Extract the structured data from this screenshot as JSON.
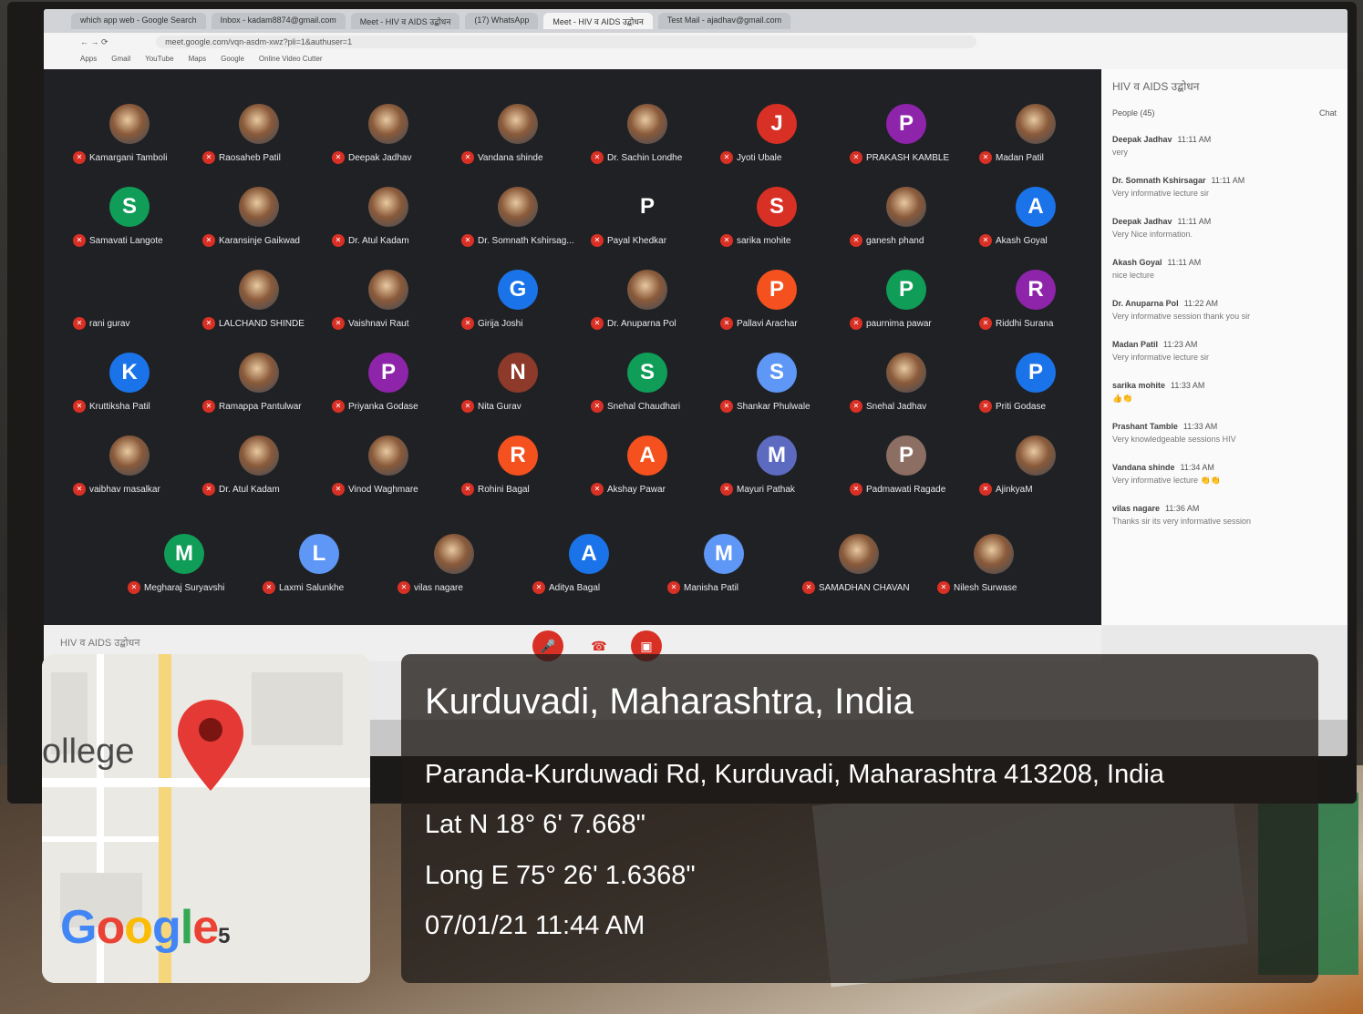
{
  "browser": {
    "tabs": [
      {
        "label": "which app web - Google Search",
        "active": false
      },
      {
        "label": "Inbox - kadam8874@gmail.com",
        "active": false
      },
      {
        "label": "Meet - HIV व AIDS उद्बोधन",
        "active": false
      },
      {
        "label": "(17) WhatsApp",
        "active": false
      },
      {
        "label": "Meet - HIV व AIDS उद्बोधन",
        "active": true
      },
      {
        "label": "Test Mail - ajadhav@gmail.com",
        "active": false
      }
    ],
    "url": "meet.google.com/vqn-asdm-xwz?pli=1&authuser=1",
    "bookmarks": [
      "Apps",
      "Gmail",
      "YouTube",
      "Maps",
      "Google",
      "Online Video Cutter"
    ]
  },
  "meet": {
    "participants": [
      {
        "name": "Kamargani Tamboli",
        "initial": "",
        "color": "",
        "photo": true
      },
      {
        "name": "Raosaheb Patil",
        "initial": "",
        "color": "",
        "photo": true
      },
      {
        "name": "Deepak Jadhav",
        "initial": "",
        "color": "",
        "photo": true
      },
      {
        "name": "Vandana shinde",
        "initial": "",
        "color": "",
        "photo": true
      },
      {
        "name": "Dr. Sachin Londhe",
        "initial": "",
        "color": "",
        "photo": true
      },
      {
        "name": "Jyoti Ubale",
        "initial": "J",
        "color": "#d93025",
        "photo": false
      },
      {
        "name": "PRAKASH KAMBLE",
        "initial": "P",
        "color": "#8e24aa",
        "photo": false
      },
      {
        "name": "Madan Patil",
        "initial": "",
        "color": "",
        "photo": true
      },
      {
        "name": "Samavati Langote",
        "initial": "S",
        "color": "#0f9d58",
        "photo": false
      },
      {
        "name": "Karansinje Gaikwad",
        "initial": "",
        "color": "",
        "photo": true
      },
      {
        "name": "Dr. Atul Kadam",
        "initial": "",
        "color": "",
        "photo": true
      },
      {
        "name": "Dr. Somnath Kshirsag...",
        "initial": "",
        "color": "",
        "photo": true
      },
      {
        "name": "Payal Khedkar",
        "initial": "P",
        "color": "#202124",
        "photo": false
      },
      {
        "name": "sarika mohite",
        "initial": "S",
        "color": "#d93025",
        "photo": false
      },
      {
        "name": "ganesh phand",
        "initial": "",
        "color": "",
        "photo": true
      },
      {
        "name": "Akash Goyal",
        "initial": "A",
        "color": "#1a73e8",
        "photo": false
      },
      {
        "name": "rani gurav",
        "initial": "",
        "color": "",
        "photo": false
      },
      {
        "name": "LALCHAND SHINDE",
        "initial": "",
        "color": "",
        "photo": true
      },
      {
        "name": "Vaishnavi Raut",
        "initial": "",
        "color": "",
        "photo": true
      },
      {
        "name": "Girija Joshi",
        "initial": "G",
        "color": "#1a73e8",
        "photo": false
      },
      {
        "name": "Dr. Anuparna Pol",
        "initial": "",
        "color": "",
        "photo": true
      },
      {
        "name": "Pallavi Arachar",
        "initial": "P",
        "color": "#f4511e",
        "photo": false
      },
      {
        "name": "paurnima pawar",
        "initial": "P",
        "color": "#0f9d58",
        "photo": false
      },
      {
        "name": "Riddhi Surana",
        "initial": "R",
        "color": "#8e24aa",
        "photo": false
      },
      {
        "name": "Kruttiksha Patil",
        "initial": "K",
        "color": "#1a73e8",
        "photo": false
      },
      {
        "name": "Ramappa Pantulwar",
        "initial": "",
        "color": "",
        "photo": true
      },
      {
        "name": "Priyanka Godase",
        "initial": "P",
        "color": "#8e24aa",
        "photo": false
      },
      {
        "name": "Nita Gurav",
        "initial": "N",
        "color": "#8d3a2a",
        "photo": false
      },
      {
        "name": "Snehal Chaudhari",
        "initial": "S",
        "color": "#0f9d58",
        "photo": false
      },
      {
        "name": "Shankar Phulwale",
        "initial": "S",
        "color": "#5e97f6",
        "photo": false
      },
      {
        "name": "Snehal Jadhav",
        "initial": "",
        "color": "",
        "photo": true
      },
      {
        "name": "Priti Godase",
        "initial": "P",
        "color": "#1a73e8",
        "photo": false
      },
      {
        "name": "vaibhav masalkar",
        "initial": "",
        "color": "",
        "photo": true
      },
      {
        "name": "Dr. Atul Kadam",
        "initial": "",
        "color": "",
        "photo": true
      },
      {
        "name": "Vinod Waghmare",
        "initial": "",
        "color": "",
        "photo": true
      },
      {
        "name": "Rohini Bagal",
        "initial": "R",
        "color": "#f4511e",
        "photo": false
      },
      {
        "name": "Akshay Pawar",
        "initial": "A",
        "color": "#f4511e",
        "photo": false
      },
      {
        "name": "Mayuri Pathak",
        "initial": "M",
        "color": "#5c6bc0",
        "photo": false
      },
      {
        "name": "Padmawati Ragade",
        "initial": "P",
        "color": "#8d6e63",
        "photo": false
      },
      {
        "name": "AjinkyaM",
        "initial": "",
        "color": "",
        "photo": true
      },
      {
        "name": "Megharaj Suryavshi",
        "initial": "M",
        "color": "#0f9d58",
        "photo": false
      },
      {
        "name": "Laxmi Salunkhe",
        "initial": "L",
        "color": "#5e97f6",
        "photo": false
      },
      {
        "name": "vilas nagare",
        "initial": "",
        "color": "",
        "photo": true
      },
      {
        "name": "Aditya Bagal",
        "initial": "A",
        "color": "#1a73e8",
        "photo": false
      },
      {
        "name": "Manisha Patil",
        "initial": "M",
        "color": "#5e97f6",
        "photo": false
      },
      {
        "name": "SAMADHAN CHAVAN",
        "initial": "",
        "color": "",
        "photo": true
      },
      {
        "name": "Nilesh Surwase",
        "initial": "",
        "color": "",
        "photo": true
      }
    ],
    "meeting_name": "HIV व AIDS उद्बोधन",
    "panel": {
      "title": "HIV व AIDS उद्बोधन",
      "people_tab": "People (45)",
      "chat_tab": "Chat",
      "messages": [
        {
          "who": "Deepak Jadhav",
          "time": "11:11 AM",
          "text": "very"
        },
        {
          "who": "Dr. Somnath Kshirsagar",
          "time": "11:11 AM",
          "text": "Very informative lecture sir"
        },
        {
          "who": "Deepak Jadhav",
          "time": "11:11 AM",
          "text": "Very Nice information."
        },
        {
          "who": "Akash Goyal",
          "time": "11:11 AM",
          "text": "nice lecture"
        },
        {
          "who": "Dr. Anuparna Pol",
          "time": "11:22 AM",
          "text": "Very informative session thank you sir"
        },
        {
          "who": "Madan Patil",
          "time": "11:23 AM",
          "text": "Very informative lecture sir"
        },
        {
          "who": "sarika mohite",
          "time": "11:33 AM",
          "text": "👍👏"
        },
        {
          "who": "Prashant Tamble",
          "time": "11:33 AM",
          "text": "Very knowledgeable sessions HIV"
        },
        {
          "who": "Vandana shinde",
          "time": "11:34 AM",
          "text": "Very informative lecture 👏👏"
        },
        {
          "who": "vilas nagare",
          "time": "11:36 AM",
          "text": "Thanks sir its very informative session"
        }
      ]
    }
  },
  "overlay": {
    "place": "Kurduvadi, Maharashtra, India",
    "address": "Paranda-Kurduwadi Rd, Kurduvadi, Maharashtra 413208, India",
    "lat": "Lat N 18° 6' 7.668\"",
    "long": "Long E 75° 26' 1.6368\"",
    "datetime": "07/01/21 11:44 AM"
  },
  "map": {
    "label": "ollege",
    "google": "Google",
    "google_num": "5",
    "pin_color": "#e53935"
  },
  "colors": {
    "meet_bg": "#202124",
    "overlay_bg": "#201c1a",
    "mute_red": "#d93025"
  }
}
